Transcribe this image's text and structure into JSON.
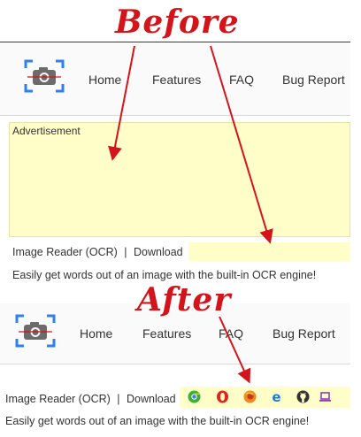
{
  "annotations": {
    "before_label": "Before",
    "after_label": "After"
  },
  "nav": {
    "items": [
      {
        "label": "Home"
      },
      {
        "label": "Features"
      },
      {
        "label": "FAQ"
      },
      {
        "label": "Bug Report"
      }
    ]
  },
  "ad": {
    "label": "Advertisement"
  },
  "app": {
    "name": "Image Reader (OCR)",
    "separator": "|",
    "download_label": "Download",
    "description": "Easily get words out of an image with the built-in OCR engine!"
  },
  "browser_icons": [
    "chrome-icon",
    "opera-icon",
    "firefox-icon",
    "edge-icon",
    "github-icon",
    "laptop-icon"
  ],
  "colors": {
    "annotation_red": "#d4141b",
    "ad_background": "#fffec8",
    "logo_blue": "#2f80ed",
    "logo_grey": "#6b6b6b",
    "chrome_green": "#3cae3c",
    "opera_red": "#e2231a",
    "firefox_orange": "#f08a24",
    "edge_blue": "#1e7bd4",
    "github_dark": "#333333",
    "laptop_purple": "#8b3fb6"
  }
}
